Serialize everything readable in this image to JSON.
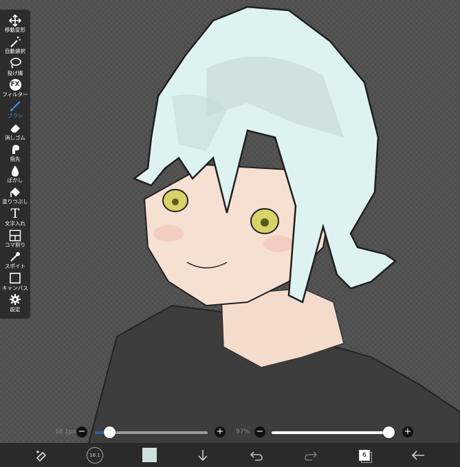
{
  "toolbar": {
    "items": [
      {
        "label": "移動変形",
        "icon": "move-icon"
      },
      {
        "label": "自動選択",
        "icon": "magic-wand-icon"
      },
      {
        "label": "投げ縄",
        "icon": "lasso-icon"
      },
      {
        "label": "フィルター",
        "icon": "fx-icon",
        "icon_text": "FX"
      },
      {
        "label": "ブラシ",
        "icon": "brush-icon",
        "active": true
      },
      {
        "label": "消しゴム",
        "icon": "eraser-icon"
      },
      {
        "label": "指先",
        "icon": "smudge-icon"
      },
      {
        "label": "ぼかし",
        "icon": "blur-icon"
      },
      {
        "label": "塗りつぶし",
        "icon": "fill-bucket-icon"
      },
      {
        "label": "文字入れ",
        "icon": "text-icon",
        "icon_text": "T"
      },
      {
        "label": "コマ割り",
        "icon": "frame-divider-icon"
      },
      {
        "label": "スポイト",
        "icon": "eyedropper-icon"
      },
      {
        "label": "キャンバス",
        "icon": "canvas-icon"
      },
      {
        "label": "設定",
        "icon": "gear-icon"
      }
    ],
    "active_color": "#3f95ea"
  },
  "brush_size": {
    "value_label": "18.1px",
    "level": 0.13,
    "fill_color": "#2f5fa5",
    "minus": "−",
    "plus": "+"
  },
  "brush_opacity": {
    "value_label": "97%",
    "level": 0.97,
    "fill_color": "#ffffff",
    "minus": "−",
    "plus": "+"
  },
  "bottombar": {
    "brush_size_badge": "18.1",
    "color_swatch": "#cde0e0",
    "layer_count": "6"
  }
}
